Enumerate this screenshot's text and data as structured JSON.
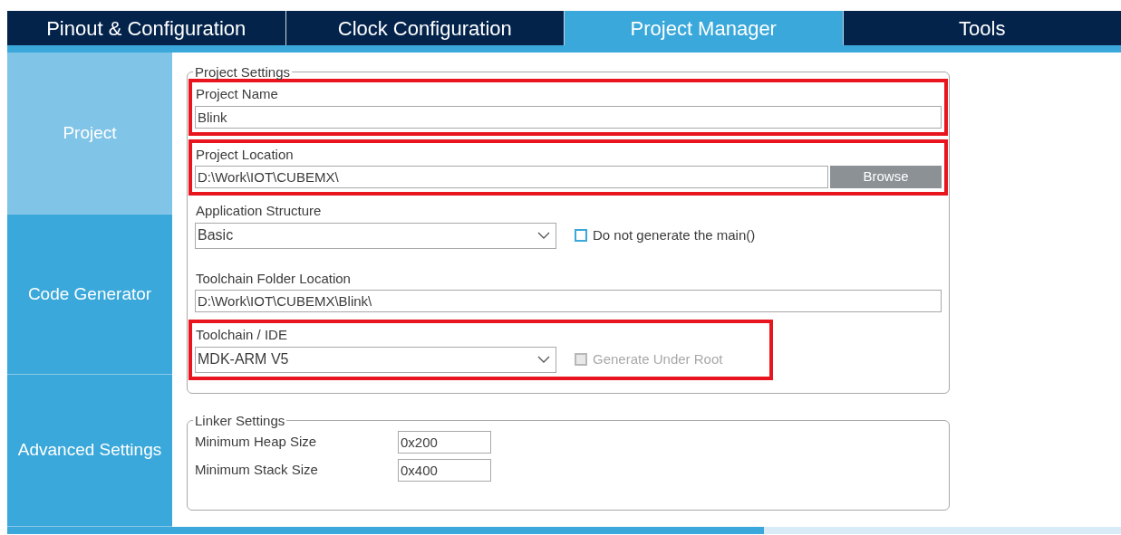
{
  "tabs": [
    {
      "label": "Pinout & Configuration",
      "selected": false
    },
    {
      "label": "Clock Configuration",
      "selected": false
    },
    {
      "label": "Project Manager",
      "selected": true
    },
    {
      "label": "Tools",
      "selected": false
    }
  ],
  "sidebar": {
    "items": [
      {
        "label": "Project",
        "selected": true
      },
      {
        "label": "Code Generator",
        "selected": false
      },
      {
        "label": "Advanced Settings",
        "selected": false
      }
    ]
  },
  "project_settings": {
    "title": "Project Settings",
    "rows": [
      {
        "kind": "text",
        "label": "Project Name",
        "value": "Blink",
        "highlighted": true
      },
      {
        "kind": "browse",
        "label": "Project Location",
        "value": "D:\\Work\\IOT\\CUBEMX\\",
        "button": "Browse",
        "highlighted": true
      },
      {
        "kind": "select",
        "label": "Application Structure",
        "value": "Basic",
        "checkbox": {
          "label": "Do not generate the main()",
          "checked": false,
          "disabled": false
        },
        "highlighted": false
      },
      {
        "kind": "text",
        "label": "Toolchain Folder Location",
        "value": "D:\\Work\\IOT\\CUBEMX\\Blink\\",
        "highlighted": false
      },
      {
        "kind": "select",
        "label": "Toolchain / IDE",
        "value": "MDK-ARM V5",
        "checkbox": {
          "label": "Generate Under Root",
          "checked": false,
          "disabled": true
        },
        "highlighted": true
      }
    ]
  },
  "linker_settings": {
    "title": "Linker Settings",
    "fields": [
      {
        "label": "Minimum Heap Size",
        "value": "0x200"
      },
      {
        "label": "Minimum Stack Size",
        "value": "0x400"
      }
    ]
  }
}
